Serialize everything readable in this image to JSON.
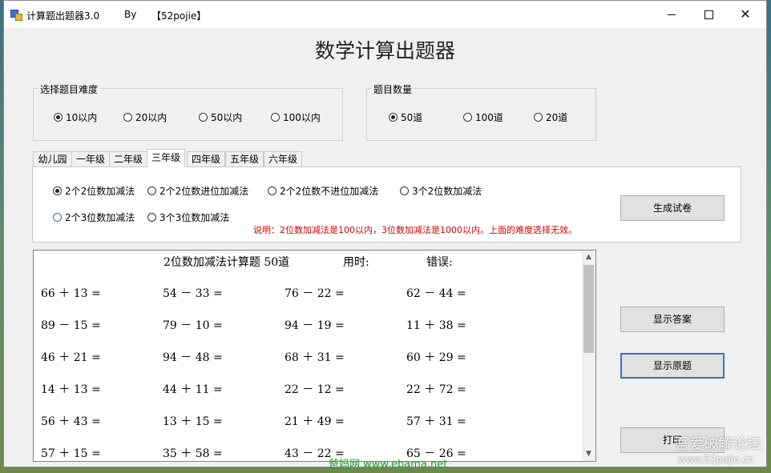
{
  "window": {
    "title": "计算题出题器3.0",
    "by": "By",
    "site": "【52pojie】",
    "minimize_glyph": "",
    "close_glyph": "✕"
  },
  "main_title": "数学计算出题器",
  "difficulty": {
    "label": "选择题目难度",
    "options": [
      "10以内",
      "20以内",
      "50以内",
      "100以内"
    ],
    "selected": "10以内"
  },
  "quantity": {
    "label": "题目数量",
    "options": [
      "50道",
      "100道",
      "20道"
    ],
    "selected": "50道"
  },
  "tabs": [
    "幼儿园",
    "一年级",
    "二年级",
    "三年级",
    "四年级",
    "五年级",
    "六年级"
  ],
  "active_tab": "三年级",
  "grade3_options": [
    "2个2位数加减法",
    "2个2位数进位加减法",
    "2个2位数不进位加减法",
    "3个2位数加减法",
    "2个3位数加减法",
    "3个3位数加减法"
  ],
  "grade3_selected": "2个2位数加减法",
  "note": "说明：2位数加减法是100以内，3位数加减法是1000以内。上面的难度选择无效。",
  "buttons": {
    "generate": "生成试卷",
    "show_answers": "显示答案",
    "show_original": "显示原题",
    "print": "打印"
  },
  "worksheet": {
    "title": "2位数加减法计算题 50道",
    "time_label": "用时:",
    "errors_label": "错误:",
    "rows": [
      [
        "66 ＋ 13 =",
        "54 － 33 =",
        "76 － 22 =",
        "62 － 44 ="
      ],
      [
        "89 － 15 =",
        "79 － 10 =",
        "94 － 19 =",
        "11 ＋ 38 ="
      ],
      [
        "46 ＋ 21 =",
        "94 － 48 =",
        "68 ＋ 31 =",
        "60 ＋ 29 ="
      ],
      [
        "14 ＋ 13 =",
        "44 ＋ 11 =",
        "22 － 12 =",
        "22 ＋ 72 ="
      ],
      [
        "56 ＋ 43 =",
        "13 ＋ 15 =",
        "21 ＋ 49 =",
        "57 ＋ 31 ="
      ],
      [
        "57 ＋ 15 =",
        "35 ＋ 58 =",
        "43 － 22 =",
        "65 － 26 ="
      ]
    ]
  },
  "scroll_icons": {
    "up": "▲",
    "down": "▼"
  },
  "watermarks": {
    "forum": "吾爱破解论坛",
    "forum_url": "www.52pojie.cn",
    "ebama": "爸妈网 www.ebama.net"
  }
}
